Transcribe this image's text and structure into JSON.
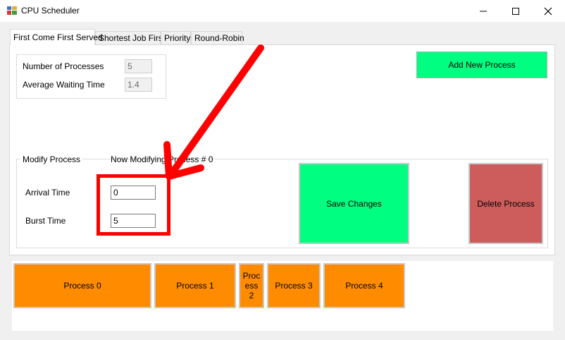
{
  "window": {
    "title": "CPU Scheduler",
    "controls": {
      "minimize": "minimize-icon",
      "maximize": "maximize-icon",
      "close": "close-icon"
    }
  },
  "tabs": [
    {
      "label": "First Come First Served",
      "active": true
    },
    {
      "label": "Shortest Job First",
      "active": false
    },
    {
      "label": "Priority",
      "active": false
    },
    {
      "label": "Round-Robin",
      "active": false
    }
  ],
  "stats": {
    "num_processes_label": "Number of Processes",
    "num_processes_value": "5",
    "avg_wait_label": "Average Waiting Time",
    "avg_wait_value": "1.4"
  },
  "add_button": "Add New Process",
  "modify": {
    "group_label": "Modify Process",
    "now_modifying": "Now Modifying Process # 0",
    "arrival_label": "Arrival Time",
    "arrival_value": "0",
    "burst_label": "Burst Time",
    "burst_value": "5",
    "save_label": "Save Changes",
    "delete_label": "Delete Process"
  },
  "processes": [
    "Process 0",
    "Process 1",
    "Process 2",
    "Process 3",
    "Process 4"
  ],
  "colors": {
    "green_button": "#00ff80",
    "delete_button": "#cd5c5c",
    "process_block": "#ff8c00",
    "annotation": "#ff0000"
  }
}
